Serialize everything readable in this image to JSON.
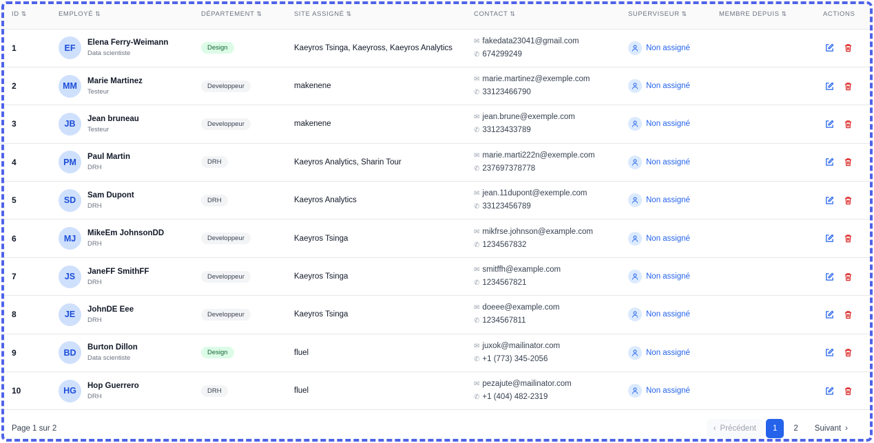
{
  "columns": [
    {
      "label": "ID",
      "sortable": true
    },
    {
      "label": "Employé",
      "sortable": true
    },
    {
      "label": "Département",
      "sortable": true
    },
    {
      "label": "Site assigné",
      "sortable": true
    },
    {
      "label": "Contact",
      "sortable": true
    },
    {
      "label": "Superviseur",
      "sortable": true
    },
    {
      "label": "Membre depuis",
      "sortable": true
    },
    {
      "label": "Actions",
      "sortable": false
    }
  ],
  "rows": [
    {
      "id": "1",
      "initials": "EF",
      "name": "Elena Ferry-Weimann",
      "role": "Data scientiste",
      "department": "Design",
      "site": "Kaeyros Tsinga, Kaeyross, Kaeyros Analytics",
      "email": "fakedata23041@gmail.com",
      "phone": "674299249",
      "supervisor": "Non assigné",
      "member_since": ""
    },
    {
      "id": "2",
      "initials": "MM",
      "name": "Marie Martinez",
      "role": "Testeur",
      "department": "Developpeur",
      "site": "makenene",
      "email": "marie.martinez@exemple.com",
      "phone": "33123466790",
      "supervisor": "Non assigné",
      "member_since": ""
    },
    {
      "id": "3",
      "initials": "JB",
      "name": "Jean bruneau",
      "role": "Testeur",
      "department": "Developpeur",
      "site": "makenene",
      "email": "jean.brune@exemple.com",
      "phone": "33123433789",
      "supervisor": "Non assigné",
      "member_since": ""
    },
    {
      "id": "4",
      "initials": "PM",
      "name": "Paul Martin",
      "role": "DRH",
      "department": "DRH",
      "site": "Kaeyros Analytics, Sharin Tour",
      "email": "marie.marti222n@exemple.com",
      "phone": "237697378778",
      "supervisor": "Non assigné",
      "member_since": ""
    },
    {
      "id": "5",
      "initials": "SD",
      "name": "Sam Dupont",
      "role": "DRH",
      "department": "DRH",
      "site": "Kaeyros Analytics",
      "email": "jean.11dupont@exemple.com",
      "phone": "33123456789",
      "supervisor": "Non assigné",
      "member_since": ""
    },
    {
      "id": "6",
      "initials": "MJ",
      "name": "MikeEm JohnsonDD",
      "role": "DRH",
      "department": "Developpeur",
      "site": "Kaeyros Tsinga",
      "email": "mikfrse.johnson@example.com",
      "phone": "1234567832",
      "supervisor": "Non assigné",
      "member_since": ""
    },
    {
      "id": "7",
      "initials": "JS",
      "name": "JaneFF SmithFF",
      "role": "DRH",
      "department": "Developpeur",
      "site": "Kaeyros Tsinga",
      "email": "smitffh@example.com",
      "phone": "1234567821",
      "supervisor": "Non assigné",
      "member_since": ""
    },
    {
      "id": "8",
      "initials": "JE",
      "name": "JohnDE Eee",
      "role": "DRH",
      "department": "Developpeur",
      "site": "Kaeyros Tsinga",
      "email": "doeee@example.com",
      "phone": "1234567811",
      "supervisor": "Non assigné",
      "member_since": ""
    },
    {
      "id": "9",
      "initials": "BD",
      "name": "Burton Dillon",
      "role": "Data scientiste",
      "department": "Design",
      "site": "fluel",
      "email": "juxok@mailinator.com",
      "phone": "+1 (773) 345-2056",
      "supervisor": "Non assigné",
      "member_since": ""
    },
    {
      "id": "10",
      "initials": "HG",
      "name": "Hop Guerrero",
      "role": "DRH",
      "department": "DRH",
      "site": "fluel",
      "email": "pezajute@mailinator.com",
      "phone": "+1 (404) 482-2319",
      "supervisor": "Non assigné",
      "member_since": ""
    }
  ],
  "footer": {
    "page_info": "Page 1 sur 2",
    "prev": "Précédent",
    "pages": [
      "1",
      "2"
    ],
    "current_page": "1",
    "next": "Suivant"
  },
  "colors": {
    "accent": "#2563eb",
    "delete": "#dc2626",
    "design_badge": "#dcfce7",
    "frame": "#4f63e7"
  }
}
